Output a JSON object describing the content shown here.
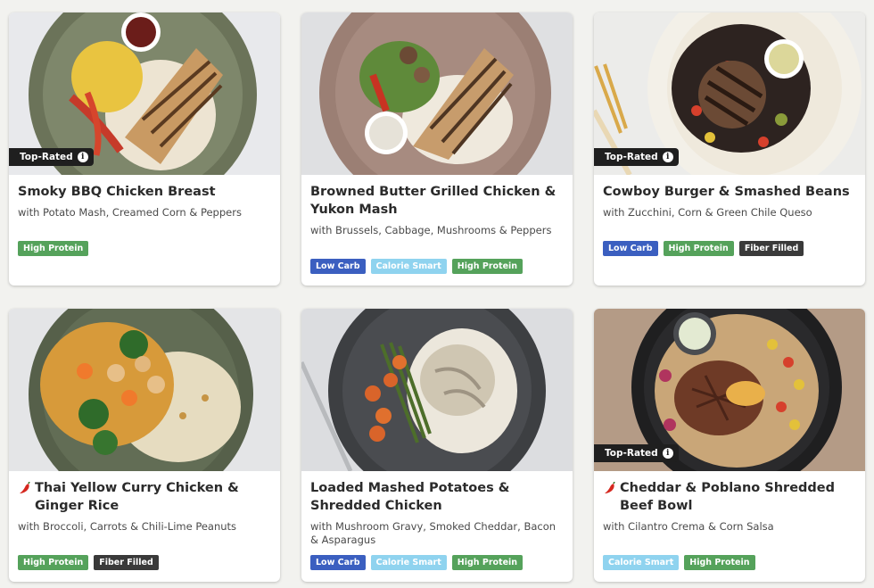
{
  "colors": {
    "high_protein": "#55a25b",
    "low_carb": "#3b5fc0",
    "calorie_smart": "#8fd3ef",
    "fiber_filled": "#3a3a3a",
    "top_rated_bg": "#1f1f1f"
  },
  "cards": [
    {
      "top_rated": "Top-Rated",
      "spicy": false,
      "title": "Smoky BBQ Chicken Breast",
      "subtitle": "with Potato Mash, Creamed Corn & Peppers",
      "tags": [
        "High Protein"
      ]
    },
    {
      "top_rated": "",
      "spicy": false,
      "title": "Browned Butter Grilled Chicken & Yukon Mash",
      "subtitle": "with Brussels, Cabbage, Mushrooms & Peppers",
      "tags": [
        "Low Carb",
        "Calorie Smart",
        "High Protein"
      ]
    },
    {
      "top_rated": "Top-Rated",
      "spicy": false,
      "title": "Cowboy Burger & Smashed Beans",
      "subtitle": "with Zucchini, Corn & Green Chile Queso",
      "tags": [
        "Low Carb",
        "High Protein",
        "Fiber Filled"
      ]
    },
    {
      "top_rated": "",
      "spicy": true,
      "title": "Thai Yellow Curry Chicken & Ginger Rice",
      "subtitle": "with Broccoli, Carrots & Chili-Lime Peanuts",
      "tags": [
        "High Protein",
        "Fiber Filled"
      ]
    },
    {
      "top_rated": "",
      "spicy": false,
      "title": "Loaded Mashed Potatoes & Shredded Chicken",
      "subtitle": "with Mushroom Gravy, Smoked Cheddar, Bacon & Asparagus",
      "tags": [
        "Low Carb",
        "Calorie Smart",
        "High Protein"
      ]
    },
    {
      "top_rated": "Top-Rated",
      "spicy": true,
      "title": "Cheddar & Poblano Shredded Beef Bowl",
      "subtitle": "with Cilantro Crema & Corn Salsa",
      "tags": [
        "Calorie Smart",
        "High Protein"
      ]
    }
  ]
}
